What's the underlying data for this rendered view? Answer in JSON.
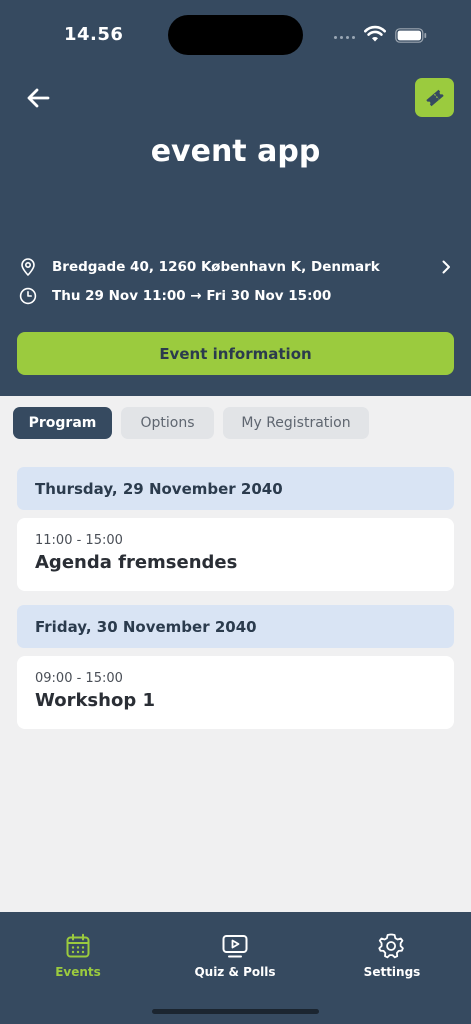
{
  "status_bar": {
    "time": "14.56"
  },
  "header": {
    "title": "event app",
    "location": "Bredgade 40, 1260 København K, Denmark",
    "datetime": "Thu 29 Nov 11:00 → Fri 30 Nov 15:00",
    "event_info_label": "Event information"
  },
  "tabs": [
    {
      "label": "Program",
      "active": true
    },
    {
      "label": "Options",
      "active": false
    },
    {
      "label": "My Registration",
      "active": false
    }
  ],
  "schedule": [
    {
      "day": "Thursday, 29 November 2040",
      "sessions": [
        {
          "time": "11:00 - 15:00",
          "title": "Agenda fremsendes"
        }
      ]
    },
    {
      "day": "Friday, 30 November 2040",
      "sessions": [
        {
          "time": "09:00 - 15:00",
          "title": "Workshop 1"
        }
      ]
    }
  ],
  "bottom_nav": [
    {
      "label": "Events",
      "icon": "calendar-icon",
      "active": true
    },
    {
      "label": "Quiz & Polls",
      "icon": "play-screen-icon",
      "active": false
    },
    {
      "label": "Settings",
      "icon": "gear-icon",
      "active": false
    }
  ],
  "colors": {
    "header_bg": "#364a60",
    "accent_green": "#9bcb3e",
    "day_header_bg": "#d9e4f4",
    "page_bg": "#f0f0f1"
  }
}
